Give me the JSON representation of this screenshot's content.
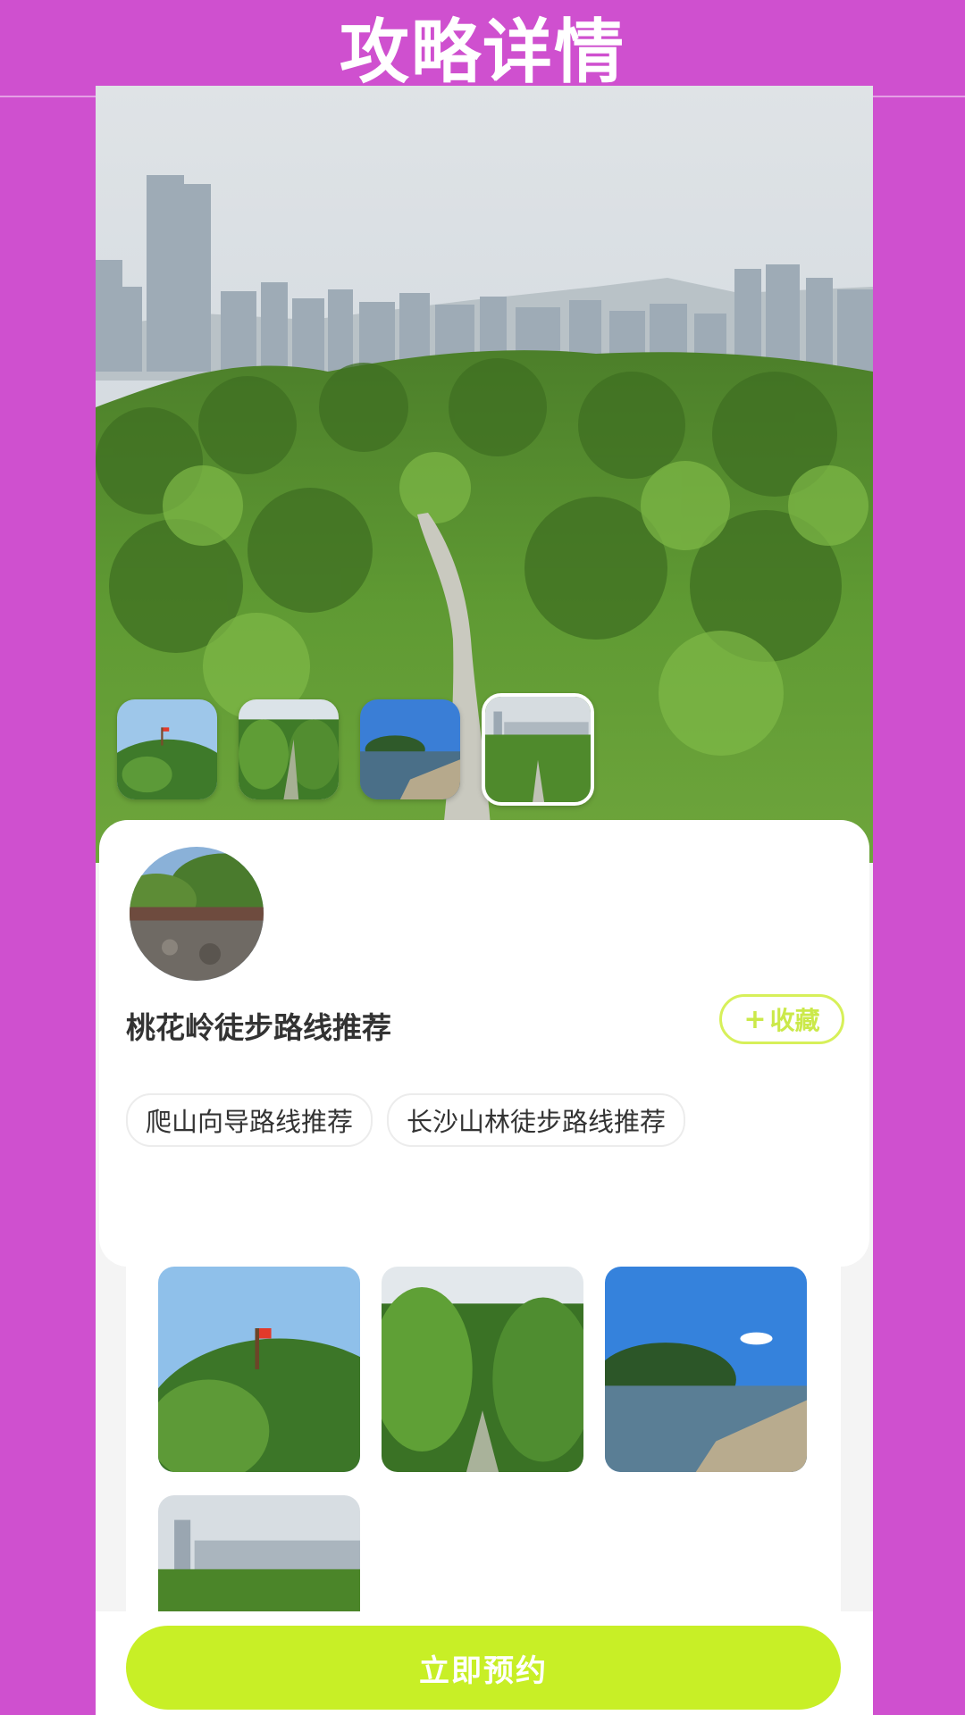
{
  "header": {
    "title": "攻略详情"
  },
  "hero": {
    "image": "forest-trail-city-skyline-photo",
    "thumbnails": [
      {
        "image": "hill-summit-flag-photo",
        "active": false
      },
      {
        "image": "forest-path-photo",
        "active": false
      },
      {
        "image": "lake-mountain-photo",
        "active": false
      },
      {
        "image": "city-forest-trail-photo",
        "active": true
      }
    ]
  },
  "info": {
    "avatar_image": "bridge-stream-photo",
    "route_title": "桃花岭徒步路线推荐",
    "collect_plus": "+",
    "collect_label": "收藏",
    "tags": [
      "爬山向导路线推荐",
      "长沙山林徒步路线推荐"
    ]
  },
  "gallery": {
    "images": [
      "hill-summit-flag-photo",
      "forest-path-photo",
      "lake-mountain-photo",
      "city-forest-trail-photo"
    ]
  },
  "footer": {
    "book_button": "立即预约"
  },
  "colors": {
    "page_background": "#cf50cf",
    "accent": "#c8ef26",
    "collect_border": "#d7f05a",
    "text_primary": "#333333"
  }
}
